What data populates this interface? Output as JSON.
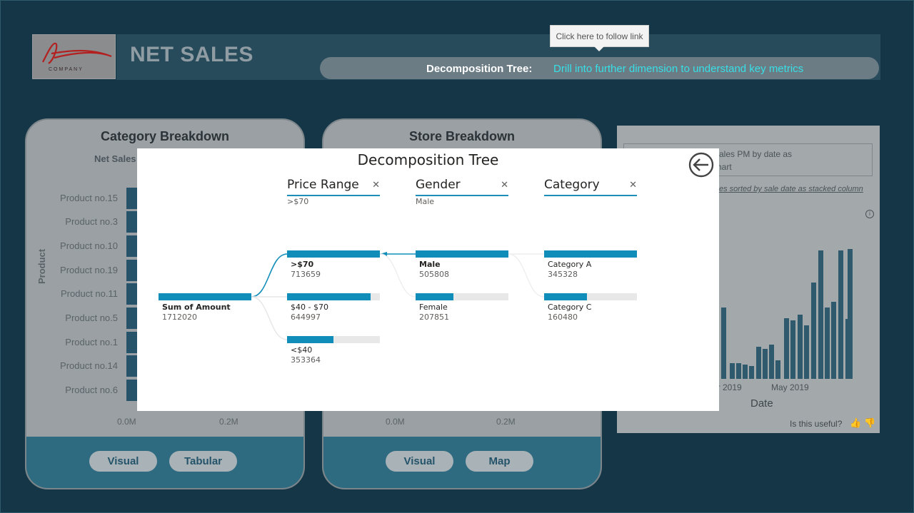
{
  "header": {
    "company": "COMPANY",
    "title": "NET SALES",
    "pill_label": "Decomposition Tree:",
    "pill_link": "Drill into further dimension to understand key metrics",
    "tooltip": "Click here to follow link"
  },
  "category_card": {
    "title": "Category Breakdown",
    "subtitle": "Net Sales",
    "y_axis": "Product",
    "products": [
      "Product no.15",
      "Product no.3",
      "Product no.10",
      "Product no.19",
      "Product no.11",
      "Product no.5",
      "Product no.1",
      "Product no.14",
      "Product no.6"
    ],
    "ticks": [
      "0.0M",
      "0.2M"
    ],
    "buttons": [
      "Visual",
      "Tabular"
    ]
  },
  "store_card": {
    "title": "Store Breakdown",
    "ticks": [
      "0.0M",
      "0.2M"
    ],
    "buttons": [
      "Visual",
      "Map"
    ]
  },
  "right_panel": {
    "qa_line1": "ales PM by date as",
    "qa_line2": "hart",
    "qa_hint": "es sorted by sale date as stacked column",
    "tick_a": "ar 2019",
    "tick_b": "May 2019",
    "axis_title": "Date",
    "useful": "Is this useful?"
  },
  "modal": {
    "title": "Decomposition Tree",
    "levels": [
      {
        "name": "Price Range",
        "selected": ">$70"
      },
      {
        "name": "Gender",
        "selected": "Male"
      },
      {
        "name": "Category",
        "selected": ""
      }
    ],
    "root": {
      "label": "Sum of Amount",
      "value": "1712020"
    },
    "price_nodes": [
      {
        "label": ">$70",
        "value": "713659",
        "fraction": 1.0,
        "bold": true
      },
      {
        "label": "$40 - $70",
        "value": "644997",
        "fraction": 0.9,
        "bold": false
      },
      {
        "label": "<$40",
        "value": "353364",
        "fraction": 0.5,
        "bold": false
      }
    ],
    "gender_nodes": [
      {
        "label": "Male",
        "value": "505808",
        "fraction": 1.0,
        "bold": true
      },
      {
        "label": "Female",
        "value": "207851",
        "fraction": 0.41,
        "bold": false
      }
    ],
    "category_nodes": [
      {
        "label": "Category A",
        "value": "345328",
        "fraction": 1.0,
        "bold": false
      },
      {
        "label": "Category C",
        "value": "160480",
        "fraction": 0.46,
        "bold": false
      }
    ]
  },
  "colors": {
    "accent": "#118dba",
    "link": "#37dfe6",
    "background": "#143646"
  }
}
